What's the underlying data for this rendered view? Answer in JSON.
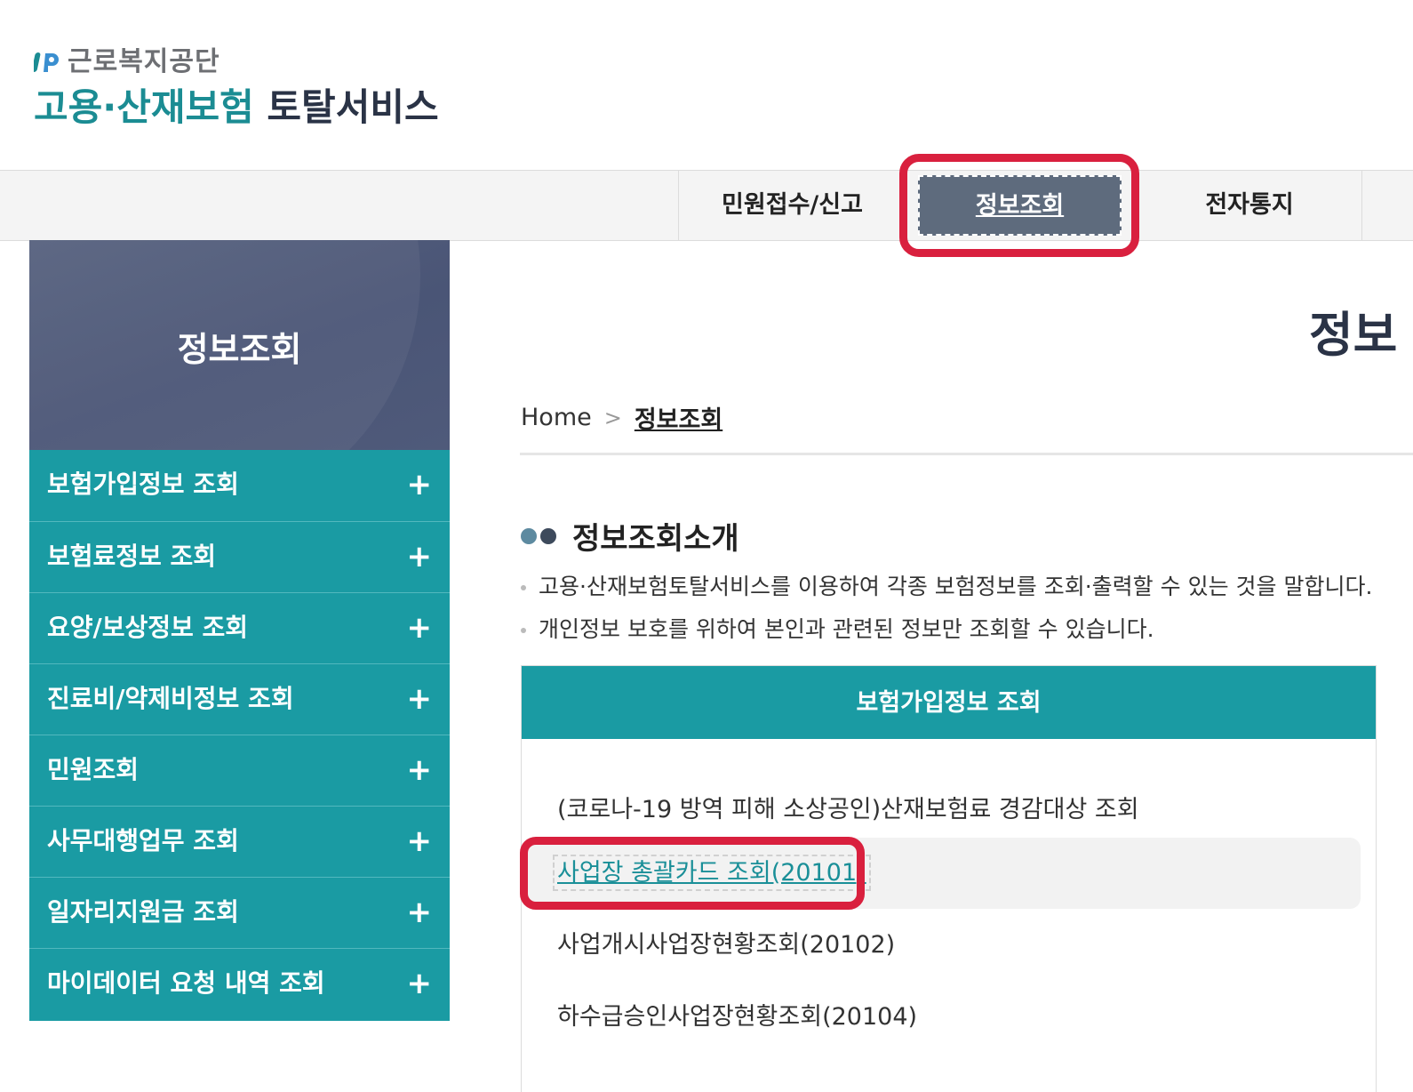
{
  "logo": {
    "org_name": "근로복지공단",
    "service_part1": "고용·산재보험",
    "service_part2": "토탈서비스"
  },
  "gnb": {
    "items": [
      "민원접수/신고",
      "정보조회",
      "전자통지"
    ],
    "active_index": 1
  },
  "sidebar": {
    "title": "정보조회",
    "items": [
      "보험가입정보 조회",
      "보험료정보 조회",
      "요양/보상정보 조회",
      "진료비/약제비정보 조회",
      "민원조회",
      "사무대행업무 조회",
      "일자리지원금 조회",
      "마이데이터 요청 내역 조회"
    ],
    "expand_symbol": "+"
  },
  "main": {
    "page_title": "정보",
    "breadcrumb": {
      "home": "Home",
      "separator": ">",
      "current": "정보조회"
    },
    "section_title": "정보조회소개",
    "description": [
      "고용·산재보험토탈서비스를 이용하여 각종 보험정보를 조회·출력할 수 있는 것을 말합니다.",
      "개인정보 보호를 위하여 본인과 관련된 정보만 조회할 수 있습니다."
    ],
    "box": {
      "title": "보험가입정보 조회",
      "items": [
        "(코로나-19 방역 피해 소상공인)산재보험료 경감대상 조회",
        "사업장 총괄카드 조회(20101)",
        "사업개시사업장현황조회(20102)",
        "하수급승인사업장현황조회(20104)"
      ],
      "highlighted_index": 1
    }
  },
  "colors": {
    "teal": "#1a9ba3",
    "navy": "#4a5576",
    "active_tab": "#5e6b7d",
    "highlight_red": "#d9203e"
  }
}
